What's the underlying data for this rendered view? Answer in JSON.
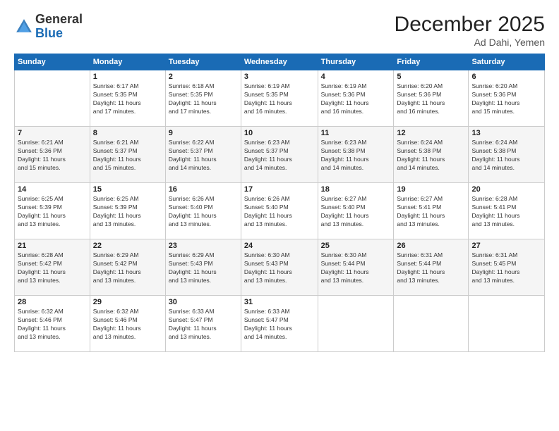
{
  "logo": {
    "general": "General",
    "blue": "Blue"
  },
  "header": {
    "month": "December 2025",
    "location": "Ad Dahi, Yemen"
  },
  "days_of_week": [
    "Sunday",
    "Monday",
    "Tuesday",
    "Wednesday",
    "Thursday",
    "Friday",
    "Saturday"
  ],
  "weeks": [
    [
      {
        "day": "",
        "sunrise": "",
        "sunset": "",
        "daylight": ""
      },
      {
        "day": "1",
        "sunrise": "6:17 AM",
        "sunset": "5:35 PM",
        "daylight": "11 hours and 17 minutes."
      },
      {
        "day": "2",
        "sunrise": "6:18 AM",
        "sunset": "5:35 PM",
        "daylight": "11 hours and 17 minutes."
      },
      {
        "day": "3",
        "sunrise": "6:19 AM",
        "sunset": "5:35 PM",
        "daylight": "11 hours and 16 minutes."
      },
      {
        "day": "4",
        "sunrise": "6:19 AM",
        "sunset": "5:36 PM",
        "daylight": "11 hours and 16 minutes."
      },
      {
        "day": "5",
        "sunrise": "6:20 AM",
        "sunset": "5:36 PM",
        "daylight": "11 hours and 16 minutes."
      },
      {
        "day": "6",
        "sunrise": "6:20 AM",
        "sunset": "5:36 PM",
        "daylight": "11 hours and 15 minutes."
      }
    ],
    [
      {
        "day": "7",
        "sunrise": "6:21 AM",
        "sunset": "5:36 PM",
        "daylight": "11 hours and 15 minutes."
      },
      {
        "day": "8",
        "sunrise": "6:21 AM",
        "sunset": "5:37 PM",
        "daylight": "11 hours and 15 minutes."
      },
      {
        "day": "9",
        "sunrise": "6:22 AM",
        "sunset": "5:37 PM",
        "daylight": "11 hours and 14 minutes."
      },
      {
        "day": "10",
        "sunrise": "6:23 AM",
        "sunset": "5:37 PM",
        "daylight": "11 hours and 14 minutes."
      },
      {
        "day": "11",
        "sunrise": "6:23 AM",
        "sunset": "5:38 PM",
        "daylight": "11 hours and 14 minutes."
      },
      {
        "day": "12",
        "sunrise": "6:24 AM",
        "sunset": "5:38 PM",
        "daylight": "11 hours and 14 minutes."
      },
      {
        "day": "13",
        "sunrise": "6:24 AM",
        "sunset": "5:38 PM",
        "daylight": "11 hours and 14 minutes."
      }
    ],
    [
      {
        "day": "14",
        "sunrise": "6:25 AM",
        "sunset": "5:39 PM",
        "daylight": "11 hours and 13 minutes."
      },
      {
        "day": "15",
        "sunrise": "6:25 AM",
        "sunset": "5:39 PM",
        "daylight": "11 hours and 13 minutes."
      },
      {
        "day": "16",
        "sunrise": "6:26 AM",
        "sunset": "5:40 PM",
        "daylight": "11 hours and 13 minutes."
      },
      {
        "day": "17",
        "sunrise": "6:26 AM",
        "sunset": "5:40 PM",
        "daylight": "11 hours and 13 minutes."
      },
      {
        "day": "18",
        "sunrise": "6:27 AM",
        "sunset": "5:40 PM",
        "daylight": "11 hours and 13 minutes."
      },
      {
        "day": "19",
        "sunrise": "6:27 AM",
        "sunset": "5:41 PM",
        "daylight": "11 hours and 13 minutes."
      },
      {
        "day": "20",
        "sunrise": "6:28 AM",
        "sunset": "5:41 PM",
        "daylight": "11 hours and 13 minutes."
      }
    ],
    [
      {
        "day": "21",
        "sunrise": "6:28 AM",
        "sunset": "5:42 PM",
        "daylight": "11 hours and 13 minutes."
      },
      {
        "day": "22",
        "sunrise": "6:29 AM",
        "sunset": "5:42 PM",
        "daylight": "11 hours and 13 minutes."
      },
      {
        "day": "23",
        "sunrise": "6:29 AM",
        "sunset": "5:43 PM",
        "daylight": "11 hours and 13 minutes."
      },
      {
        "day": "24",
        "sunrise": "6:30 AM",
        "sunset": "5:43 PM",
        "daylight": "11 hours and 13 minutes."
      },
      {
        "day": "25",
        "sunrise": "6:30 AM",
        "sunset": "5:44 PM",
        "daylight": "11 hours and 13 minutes."
      },
      {
        "day": "26",
        "sunrise": "6:31 AM",
        "sunset": "5:44 PM",
        "daylight": "11 hours and 13 minutes."
      },
      {
        "day": "27",
        "sunrise": "6:31 AM",
        "sunset": "5:45 PM",
        "daylight": "11 hours and 13 minutes."
      }
    ],
    [
      {
        "day": "28",
        "sunrise": "6:32 AM",
        "sunset": "5:46 PM",
        "daylight": "11 hours and 13 minutes."
      },
      {
        "day": "29",
        "sunrise": "6:32 AM",
        "sunset": "5:46 PM",
        "daylight": "11 hours and 13 minutes."
      },
      {
        "day": "30",
        "sunrise": "6:33 AM",
        "sunset": "5:47 PM",
        "daylight": "11 hours and 13 minutes."
      },
      {
        "day": "31",
        "sunrise": "6:33 AM",
        "sunset": "5:47 PM",
        "daylight": "11 hours and 14 minutes."
      },
      {
        "day": "",
        "sunrise": "",
        "sunset": "",
        "daylight": ""
      },
      {
        "day": "",
        "sunrise": "",
        "sunset": "",
        "daylight": ""
      },
      {
        "day": "",
        "sunrise": "",
        "sunset": "",
        "daylight": ""
      }
    ]
  ],
  "labels": {
    "sunrise": "Sunrise:",
    "sunset": "Sunset:",
    "daylight": "Daylight:"
  }
}
